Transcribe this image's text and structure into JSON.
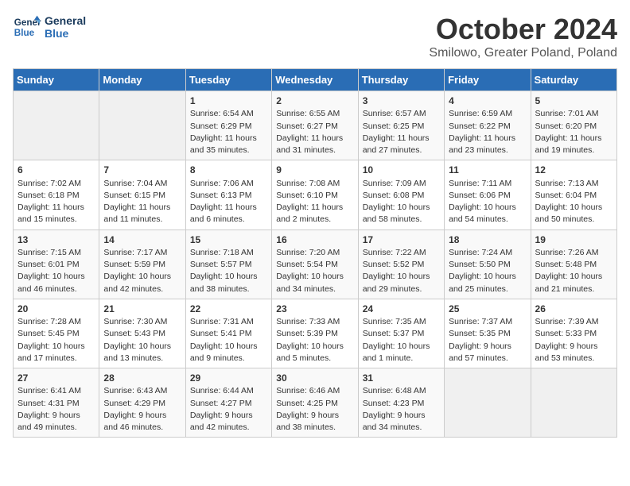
{
  "header": {
    "logo_line1": "General",
    "logo_line2": "Blue",
    "month": "October 2024",
    "location": "Smilowo, Greater Poland, Poland"
  },
  "weekdays": [
    "Sunday",
    "Monday",
    "Tuesday",
    "Wednesday",
    "Thursday",
    "Friday",
    "Saturday"
  ],
  "weeks": [
    [
      {
        "day": "",
        "data": ""
      },
      {
        "day": "",
        "data": ""
      },
      {
        "day": "1",
        "data": "Sunrise: 6:54 AM\nSunset: 6:29 PM\nDaylight: 11 hours and 35 minutes."
      },
      {
        "day": "2",
        "data": "Sunrise: 6:55 AM\nSunset: 6:27 PM\nDaylight: 11 hours and 31 minutes."
      },
      {
        "day": "3",
        "data": "Sunrise: 6:57 AM\nSunset: 6:25 PM\nDaylight: 11 hours and 27 minutes."
      },
      {
        "day": "4",
        "data": "Sunrise: 6:59 AM\nSunset: 6:22 PM\nDaylight: 11 hours and 23 minutes."
      },
      {
        "day": "5",
        "data": "Sunrise: 7:01 AM\nSunset: 6:20 PM\nDaylight: 11 hours and 19 minutes."
      }
    ],
    [
      {
        "day": "6",
        "data": "Sunrise: 7:02 AM\nSunset: 6:18 PM\nDaylight: 11 hours and 15 minutes."
      },
      {
        "day": "7",
        "data": "Sunrise: 7:04 AM\nSunset: 6:15 PM\nDaylight: 11 hours and 11 minutes."
      },
      {
        "day": "8",
        "data": "Sunrise: 7:06 AM\nSunset: 6:13 PM\nDaylight: 11 hours and 6 minutes."
      },
      {
        "day": "9",
        "data": "Sunrise: 7:08 AM\nSunset: 6:10 PM\nDaylight: 11 hours and 2 minutes."
      },
      {
        "day": "10",
        "data": "Sunrise: 7:09 AM\nSunset: 6:08 PM\nDaylight: 10 hours and 58 minutes."
      },
      {
        "day": "11",
        "data": "Sunrise: 7:11 AM\nSunset: 6:06 PM\nDaylight: 10 hours and 54 minutes."
      },
      {
        "day": "12",
        "data": "Sunrise: 7:13 AM\nSunset: 6:04 PM\nDaylight: 10 hours and 50 minutes."
      }
    ],
    [
      {
        "day": "13",
        "data": "Sunrise: 7:15 AM\nSunset: 6:01 PM\nDaylight: 10 hours and 46 minutes."
      },
      {
        "day": "14",
        "data": "Sunrise: 7:17 AM\nSunset: 5:59 PM\nDaylight: 10 hours and 42 minutes."
      },
      {
        "day": "15",
        "data": "Sunrise: 7:18 AM\nSunset: 5:57 PM\nDaylight: 10 hours and 38 minutes."
      },
      {
        "day": "16",
        "data": "Sunrise: 7:20 AM\nSunset: 5:54 PM\nDaylight: 10 hours and 34 minutes."
      },
      {
        "day": "17",
        "data": "Sunrise: 7:22 AM\nSunset: 5:52 PM\nDaylight: 10 hours and 29 minutes."
      },
      {
        "day": "18",
        "data": "Sunrise: 7:24 AM\nSunset: 5:50 PM\nDaylight: 10 hours and 25 minutes."
      },
      {
        "day": "19",
        "data": "Sunrise: 7:26 AM\nSunset: 5:48 PM\nDaylight: 10 hours and 21 minutes."
      }
    ],
    [
      {
        "day": "20",
        "data": "Sunrise: 7:28 AM\nSunset: 5:45 PM\nDaylight: 10 hours and 17 minutes."
      },
      {
        "day": "21",
        "data": "Sunrise: 7:30 AM\nSunset: 5:43 PM\nDaylight: 10 hours and 13 minutes."
      },
      {
        "day": "22",
        "data": "Sunrise: 7:31 AM\nSunset: 5:41 PM\nDaylight: 10 hours and 9 minutes."
      },
      {
        "day": "23",
        "data": "Sunrise: 7:33 AM\nSunset: 5:39 PM\nDaylight: 10 hours and 5 minutes."
      },
      {
        "day": "24",
        "data": "Sunrise: 7:35 AM\nSunset: 5:37 PM\nDaylight: 10 hours and 1 minute."
      },
      {
        "day": "25",
        "data": "Sunrise: 7:37 AM\nSunset: 5:35 PM\nDaylight: 9 hours and 57 minutes."
      },
      {
        "day": "26",
        "data": "Sunrise: 7:39 AM\nSunset: 5:33 PM\nDaylight: 9 hours and 53 minutes."
      }
    ],
    [
      {
        "day": "27",
        "data": "Sunrise: 6:41 AM\nSunset: 4:31 PM\nDaylight: 9 hours and 49 minutes."
      },
      {
        "day": "28",
        "data": "Sunrise: 6:43 AM\nSunset: 4:29 PM\nDaylight: 9 hours and 46 minutes."
      },
      {
        "day": "29",
        "data": "Sunrise: 6:44 AM\nSunset: 4:27 PM\nDaylight: 9 hours and 42 minutes."
      },
      {
        "day": "30",
        "data": "Sunrise: 6:46 AM\nSunset: 4:25 PM\nDaylight: 9 hours and 38 minutes."
      },
      {
        "day": "31",
        "data": "Sunrise: 6:48 AM\nSunset: 4:23 PM\nDaylight: 9 hours and 34 minutes."
      },
      {
        "day": "",
        "data": ""
      },
      {
        "day": "",
        "data": ""
      }
    ]
  ]
}
